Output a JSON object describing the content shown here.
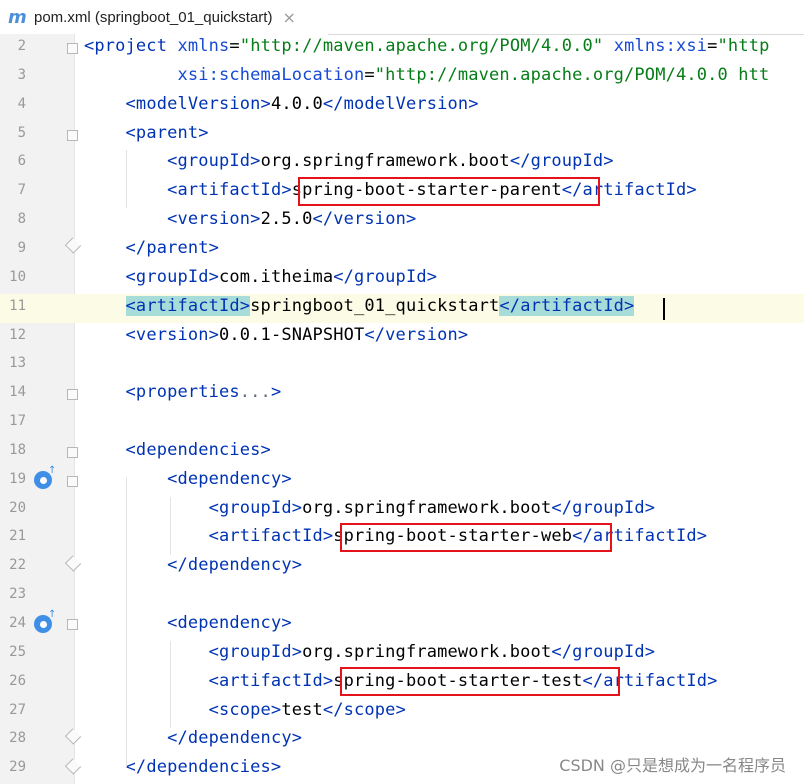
{
  "tab": {
    "title": "pom.xml (springboot_01_quickstart)",
    "icon": "maven-m-icon",
    "close": "×"
  },
  "lines": [
    {
      "n": "2",
      "html": "<span class='t'>&lt;project</span> <span class='a'>xmlns</span>=<span class='s'>\"http://maven.apache.org/POM/4.0.0\"</span> <span class='a'>xmlns:xsi</span>=<span class='s'>\"http</span>"
    },
    {
      "n": "3",
      "html": "         <span class='a'>xsi:schemaLocation</span>=<span class='s'>\"http://maven.apache.org/POM/4.0.0 htt</span>"
    },
    {
      "n": "4",
      "html": "    <span class='t'>&lt;modelVersion&gt;</span>4.0.0<span class='t'>&lt;/modelVersion&gt;</span>"
    },
    {
      "n": "5",
      "html": "    <span class='t'>&lt;parent&gt;</span>"
    },
    {
      "n": "6",
      "html": "        <span class='t'>&lt;groupId&gt;</span>org.springframework.boot<span class='t'>&lt;/groupId&gt;</span>"
    },
    {
      "n": "7",
      "html": "        <span class='t'>&lt;artifactId&gt;</span>spring-boot-starter-parent<span class='t'>&lt;/artifactId&gt;</span>"
    },
    {
      "n": "8",
      "html": "        <span class='t'>&lt;version&gt;</span>2.5.0<span class='t'>&lt;/version&gt;</span>"
    },
    {
      "n": "9",
      "html": "    <span class='t'>&lt;/parent&gt;</span>"
    },
    {
      "n": "10",
      "html": "    <span class='t'>&lt;groupId&gt;</span>com.itheima<span class='t'>&lt;/groupId&gt;</span>"
    },
    {
      "n": "11",
      "html": "    <span class='t hl'>&lt;artifactId&gt;</span>springboot_01_quickstart<span class='t hl'>&lt;/artifactId&gt;</span>",
      "current": true
    },
    {
      "n": "12",
      "html": "    <span class='t'>&lt;version&gt;</span>0.0.1-SNAPSHOT<span class='t'>&lt;/version&gt;</span>"
    },
    {
      "n": "13",
      "html": ""
    },
    {
      "n": "14",
      "html": "    <span class='t'>&lt;properties</span><span class='fold'>...</span><span class='t'>&gt;</span>"
    },
    {
      "n": "17",
      "html": ""
    },
    {
      "n": "18",
      "html": "    <span class='t'>&lt;dependencies&gt;</span>"
    },
    {
      "n": "19",
      "html": "        <span class='t'>&lt;dependency&gt;</span>"
    },
    {
      "n": "20",
      "html": "            <span class='t'>&lt;groupId&gt;</span>org.springframework.boot<span class='t'>&lt;/groupId&gt;</span>"
    },
    {
      "n": "21",
      "html": "            <span class='t'>&lt;artifactId&gt;</span>spring-boot-starter-web<span class='t'>&lt;/artifactId&gt;</span>"
    },
    {
      "n": "22",
      "html": "        <span class='t'>&lt;/dependency&gt;</span>"
    },
    {
      "n": "23",
      "html": ""
    },
    {
      "n": "24",
      "html": "        <span class='t'>&lt;dependency&gt;</span>"
    },
    {
      "n": "25",
      "html": "            <span class='t'>&lt;groupId&gt;</span>org.springframework.boot<span class='t'>&lt;/groupId&gt;</span>"
    },
    {
      "n": "26",
      "html": "            <span class='t'>&lt;artifactId&gt;</span>spring-boot-starter-test<span class='t'>&lt;/artifactId&gt;</span>"
    },
    {
      "n": "27",
      "html": "            <span class='t'>&lt;scope&gt;</span>test<span class='t'>&lt;/scope&gt;</span>"
    },
    {
      "n": "28",
      "html": "        <span class='t'>&lt;/dependency&gt;</span>"
    },
    {
      "n": "29",
      "html": "    <span class='t'>&lt;/dependencies&gt;</span>"
    }
  ],
  "watermark": "CSDN @只是想成为一名程序员",
  "colors": {
    "tag": "#0033b3",
    "attr": "#174ad4",
    "string": "#067d17",
    "highlight_box": "#e4131b"
  }
}
